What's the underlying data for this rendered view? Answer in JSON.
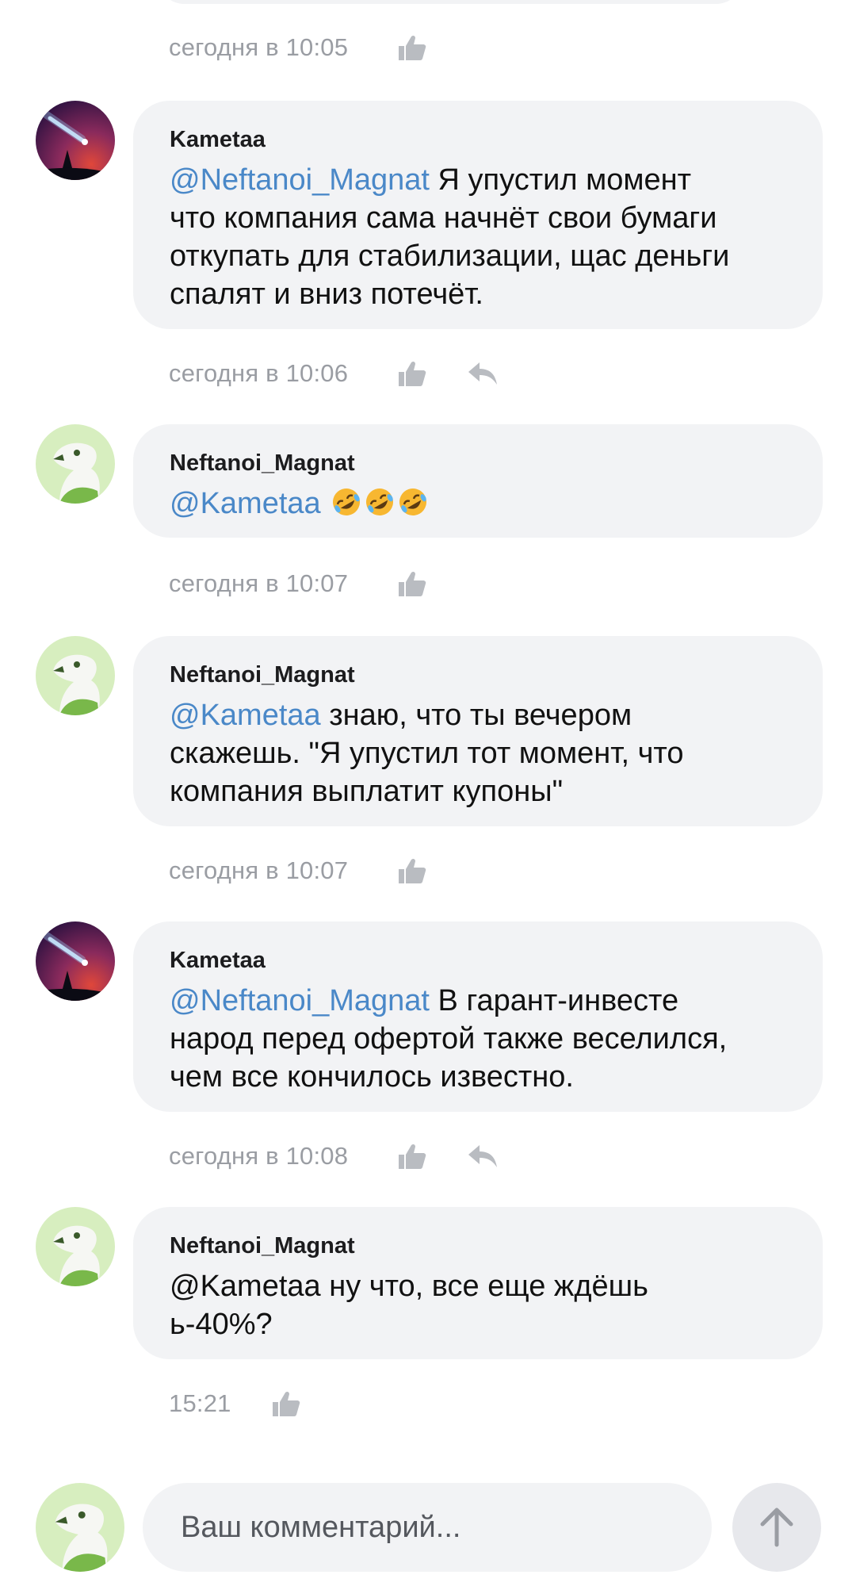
{
  "comments_top": {
    "time": "сегодня в 10:05"
  },
  "comments": [
    {
      "author": "Kametaa",
      "mention": "@Neftanoi_Magnat",
      "text_lines": [
        " Я упустил момент",
        "что компания сама начнёт свои бумаги",
        "откупать для стабилизации, щас деньги",
        "спалят и вниз потечёт."
      ],
      "time": "сегодня в 10:06",
      "has_reply": true,
      "avatar": "comet-avatar"
    },
    {
      "author": "Neftanoi_Magnat",
      "mention": "@Kametaa",
      "text_lines": [
        " "
      ],
      "emojis": [
        "rolling-on-floor-laughing",
        "rolling-on-floor-laughing",
        "rolling-on-floor-laughing"
      ],
      "time": "сегодня в 10:07",
      "has_reply": false,
      "avatar": "bird-avatar"
    },
    {
      "author": "Neftanoi_Magnat",
      "mention": "@Kametaa",
      "text_lines": [
        " знаю, что ты вечером",
        "скажешь. \"Я упустил тот момент, что",
        "компания выплатит купоны\""
      ],
      "time": "сегодня в 10:07",
      "has_reply": false,
      "avatar": "bird-avatar"
    },
    {
      "author": "Kametaa",
      "mention": "@Neftanoi_Magnat",
      "text_lines": [
        " В гарант-инвесте",
        "народ перед офертой также веселился,",
        "чем все кончилось известно."
      ],
      "time": "сегодня в 10:08",
      "has_reply": true,
      "avatar": "comet-avatar"
    },
    {
      "author": "Neftanoi_Magnat",
      "mention": "",
      "text_lines": [
        "@Kametaa ну что, все еще ждёшь",
        "ь-40%?"
      ],
      "time": "15:21",
      "has_reply": false,
      "avatar": "bird-avatar"
    }
  ],
  "composer": {
    "placeholder": "Ваш комментарий..."
  },
  "icons": {
    "like": "thumbs-up-icon",
    "reply": "reply-arrow-icon",
    "send": "arrow-up-icon"
  },
  "colors": {
    "mention": "#4a88c8",
    "bubble": "#f2f3f5",
    "meta": "#9a9da3"
  }
}
